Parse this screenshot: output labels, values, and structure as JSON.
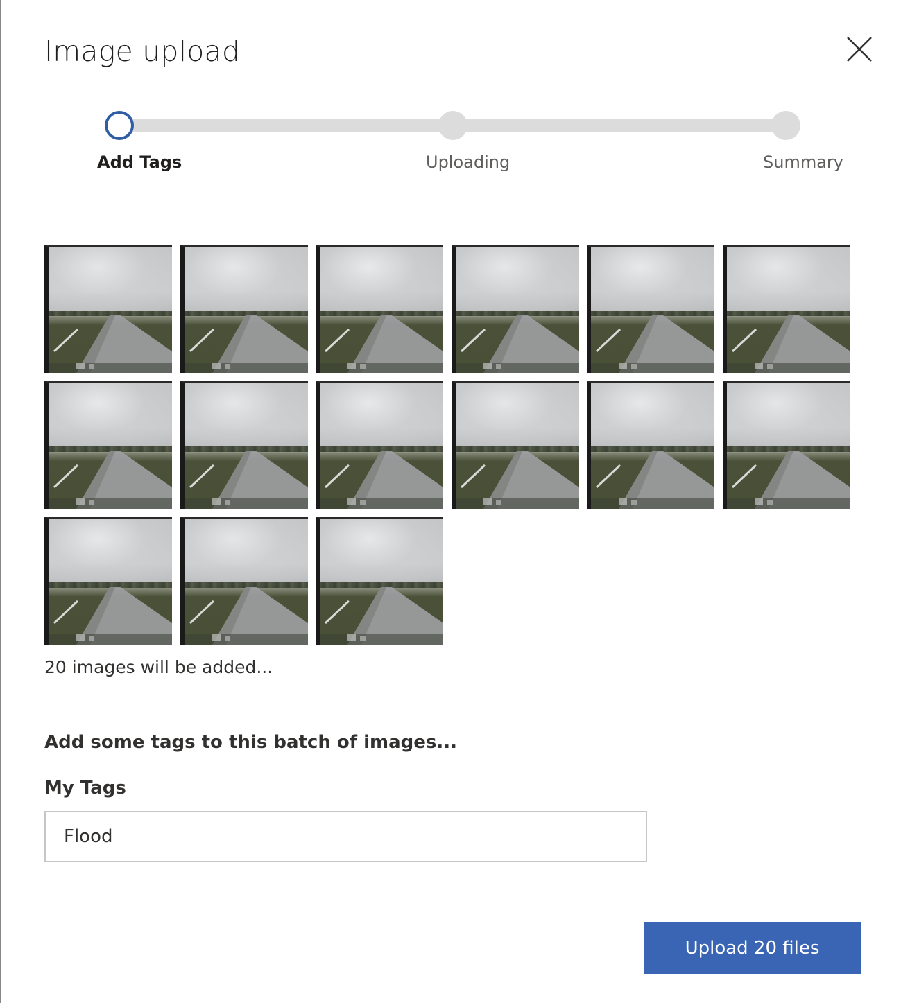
{
  "dialog": {
    "title": "Image upload",
    "close_icon": "close-icon"
  },
  "stepper": {
    "steps": [
      {
        "label": "Add Tags",
        "state": "active"
      },
      {
        "label": "Uploading",
        "state": "pending"
      },
      {
        "label": "Summary",
        "state": "pending"
      }
    ],
    "active_color": "#2f5ea5",
    "pending_color": "#dcdcdc"
  },
  "thumbnails": {
    "visible_count": 15,
    "description_icon": "image-thumbnail"
  },
  "main": {
    "count_text": "20 images will be added...",
    "section_heading": "Add some tags to this batch of images...",
    "tags_label": "My Tags",
    "tags_value": "Flood"
  },
  "footer": {
    "upload_label": "Upload 20 files",
    "upload_color": "#3a65b4"
  }
}
